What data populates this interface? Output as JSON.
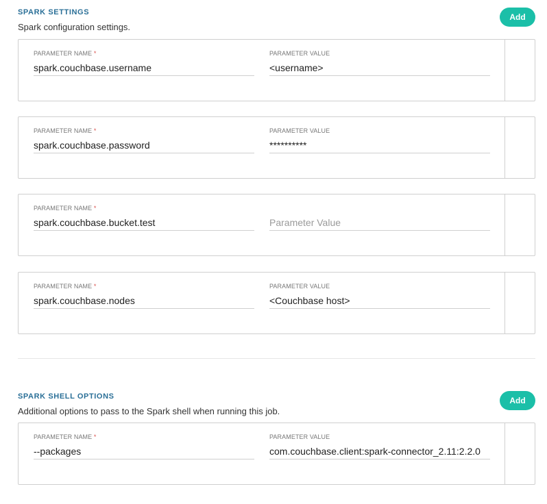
{
  "spark_settings": {
    "title": "SPARK SETTINGS",
    "description": "Spark configuration settings.",
    "add_label": "Add",
    "rows": [
      {
        "name_label": "PARAMETER NAME",
        "value_label": "PARAMETER VALUE",
        "name": "spark.couchbase.username",
        "value": "<username>",
        "value_placeholder": "Parameter Value"
      },
      {
        "name_label": "PARAMETER NAME",
        "value_label": "PARAMETER VALUE",
        "name": "spark.couchbase.password",
        "value": "**********",
        "value_placeholder": "Parameter Value"
      },
      {
        "name_label": "PARAMETER NAME",
        "value_label": "",
        "name": "spark.couchbase.bucket.test",
        "value": "",
        "value_placeholder": "Parameter Value"
      },
      {
        "name_label": "PARAMETER NAME",
        "value_label": "PARAMETER VALUE",
        "name": "spark.couchbase.nodes",
        "value": "<Couchbase host>",
        "value_placeholder": "Parameter Value"
      }
    ]
  },
  "spark_shell_options": {
    "title": "SPARK SHELL OPTIONS",
    "description": "Additional options to pass to the Spark shell when running this job.",
    "add_label": "Add",
    "rows": [
      {
        "name_label": "PARAMETER NAME",
        "value_label": "PARAMETER VALUE",
        "name": "--packages",
        "value": "com.couchbase.client:spark-connector_2.11:2.2.0",
        "value_placeholder": "Parameter Value"
      }
    ]
  },
  "required_marker": "*",
  "colors": {
    "accent": "#1bbfa8",
    "title": "#2a6f97",
    "required": "#d9534f"
  }
}
